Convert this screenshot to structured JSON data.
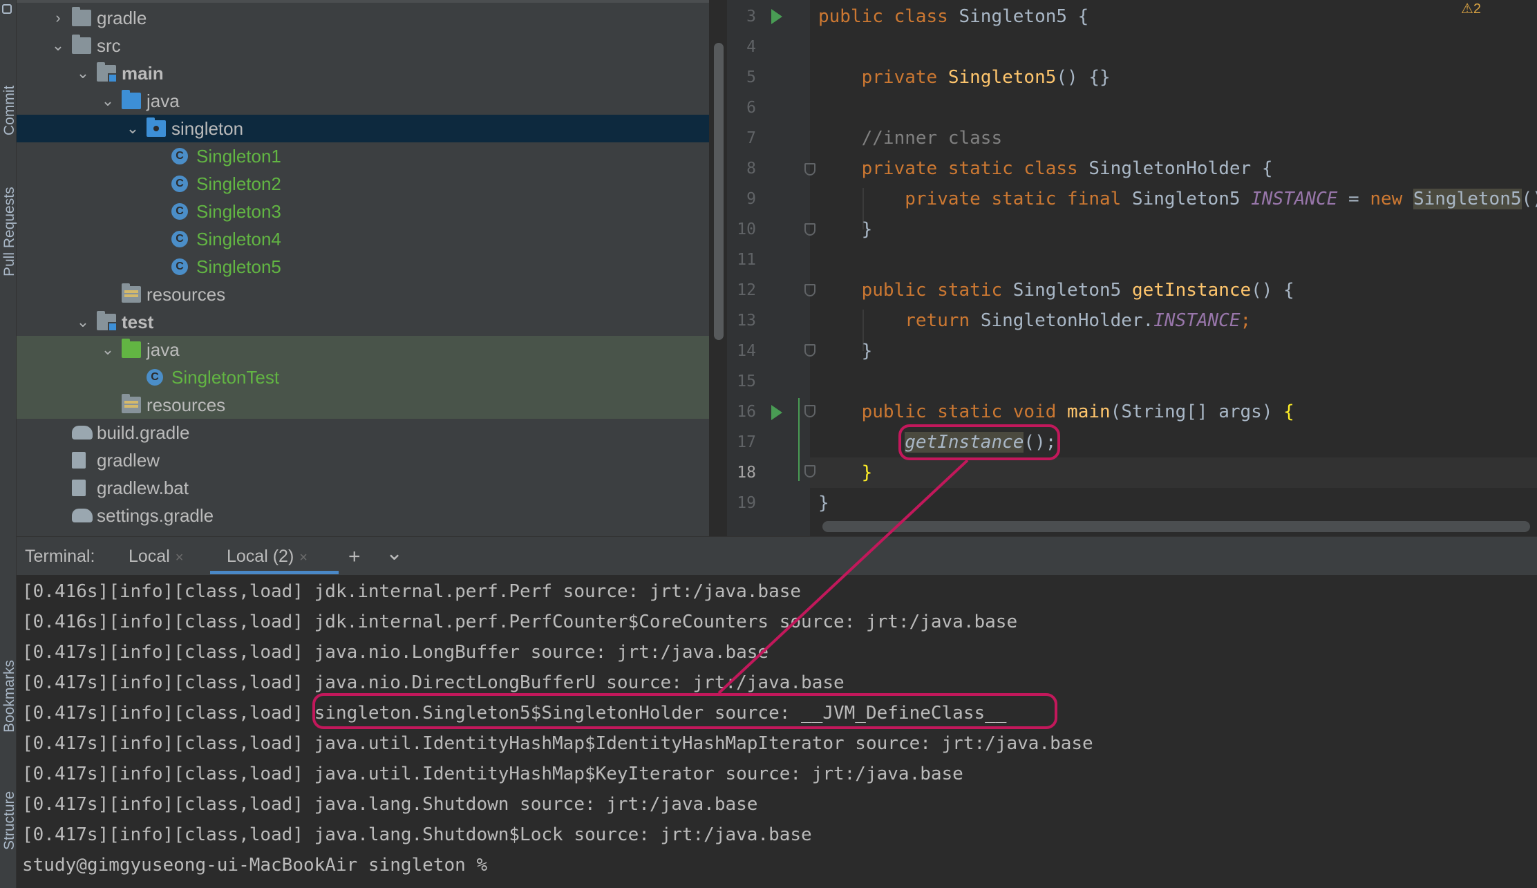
{
  "side_tabs": [
    "Commit",
    "Pull Requests",
    "Bookmarks",
    "Structure"
  ],
  "project_tree": [
    {
      "label": "gradle",
      "depth": 0,
      "icon": "folder-icon",
      "arrow": "›"
    },
    {
      "label": "src",
      "depth": 0,
      "icon": "folder-icon",
      "arrow": "⌄"
    },
    {
      "label": "main",
      "depth": 1,
      "icon": "module-folder-icon",
      "arrow": "⌄",
      "bold": true
    },
    {
      "label": "java",
      "depth": 2,
      "icon": "source-folder-icon",
      "arrow": "⌄"
    },
    {
      "label": "singleton",
      "depth": 3,
      "icon": "package-icon",
      "arrow": "⌄",
      "selected": true
    },
    {
      "label": "Singleton1",
      "depth": 4,
      "icon": "class-icon",
      "green": true
    },
    {
      "label": "Singleton2",
      "depth": 4,
      "icon": "class-icon",
      "green": true
    },
    {
      "label": "Singleton3",
      "depth": 4,
      "icon": "class-icon",
      "green": true
    },
    {
      "label": "Singleton4",
      "depth": 4,
      "icon": "class-icon",
      "green": true
    },
    {
      "label": "Singleton5",
      "depth": 4,
      "icon": "runnable-class-icon",
      "green": true
    },
    {
      "label": "resources",
      "depth": 2,
      "icon": "resources-folder-icon"
    },
    {
      "label": "test",
      "depth": 1,
      "icon": "test-module-folder-icon",
      "arrow": "⌄",
      "bold": true
    },
    {
      "label": "java",
      "depth": 2,
      "icon": "test-source-folder-icon",
      "arrow": "⌄",
      "test": true
    },
    {
      "label": "SingletonTest",
      "depth": 3,
      "icon": "runnable-class-icon",
      "green": true,
      "test": true
    },
    {
      "label": "resources",
      "depth": 2,
      "icon": "test-resources-folder-icon",
      "test": true
    },
    {
      "label": "build.gradle",
      "depth": 0,
      "icon": "gradle-icon",
      "leaf": true
    },
    {
      "label": "gradlew",
      "depth": 0,
      "icon": "script-icon",
      "leaf": true
    },
    {
      "label": "gradlew.bat",
      "depth": 0,
      "icon": "file-icon",
      "leaf": true
    },
    {
      "label": "settings.gradle",
      "depth": 0,
      "icon": "gradle-icon",
      "leaf": true
    }
  ],
  "editor": {
    "line_numbers": [
      "3",
      "4",
      "5",
      "6",
      "7",
      "8",
      "9",
      "10",
      "11",
      "12",
      "13",
      "14",
      "15",
      "16",
      "17",
      "18",
      "19"
    ],
    "current_line": "18",
    "warning_badge": "⚠2",
    "code": {
      "l3": {
        "kw": "public class ",
        "rest": "Singleton5 {"
      },
      "l5": {
        "kw": "private ",
        "fn": "Singleton5",
        "rest": "() {}"
      },
      "l7": {
        "comment": "//inner class"
      },
      "l8": {
        "kw": "private static class ",
        "rest": "SingletonHolder {"
      },
      "l9": {
        "kw": "private static final ",
        "type": "Singleton5 ",
        "field": "INSTANCE",
        "eq": " = ",
        "kw2": "new ",
        "ctor": "Singleton5",
        "tail": "()"
      },
      "l10": {
        "rest": "}"
      },
      "l12": {
        "kw": "public static ",
        "type": "Singleton5 ",
        "fn": "getInstance",
        "rest": "() {"
      },
      "l13": {
        "kw": "return ",
        "type": "SingletonHolder.",
        "field": "INSTANCE",
        "tail": ";"
      },
      "l14": {
        "rest": "}"
      },
      "l16": {
        "kw": "public static void ",
        "fn": "main",
        "rest": "(String[] args) ",
        "brace": "{"
      },
      "l17": {
        "call": "getInstance",
        "rest": "();"
      },
      "l18": {
        "brace": "}"
      },
      "l19": {
        "rest": "}"
      }
    }
  },
  "terminal": {
    "title": "Terminal:",
    "tabs": [
      {
        "label": "Local",
        "close": "×"
      },
      {
        "label": "Local (2)",
        "close": "×",
        "active": true
      }
    ],
    "add_label": "+",
    "menu_label": "⌄",
    "prefix": "[0.417s][info][class,load] ",
    "lines": [
      "[0.416s][info][class,load] jdk.internal.perf.Perf source: jrt:/java.base",
      "[0.416s][info][class,load] jdk.internal.perf.PerfCounter$CoreCounters source: jrt:/java.base",
      "[0.417s][info][class,load] java.nio.LongBuffer source: jrt:/java.base",
      "[0.417s][info][class,load] java.nio.DirectLongBufferU source: jrt:/java.base",
      "[0.417s][info][class,load] singleton.Singleton5$SingletonHolder source: __JVM_DefineClass__",
      "[0.417s][info][class,load] java.util.IdentityHashMap$IdentityHashMapIterator source: jrt:/java.base",
      "[0.417s][info][class,load] java.util.IdentityHashMap$KeyIterator source: jrt:/java.base",
      "[0.417s][info][class,load] java.lang.Shutdown source: jrt:/java.base",
      "[0.417s][info][class,load] java.lang.Shutdown$Lock source: jrt:/java.base",
      "study@gimgyuseong-ui-MacBookAir singleton %"
    ]
  },
  "colors": {
    "annotation": "#c2185b",
    "keyword": "#cc7832",
    "function": "#ffc66d",
    "field": "#9876aa",
    "selection": "#0d293e"
  }
}
